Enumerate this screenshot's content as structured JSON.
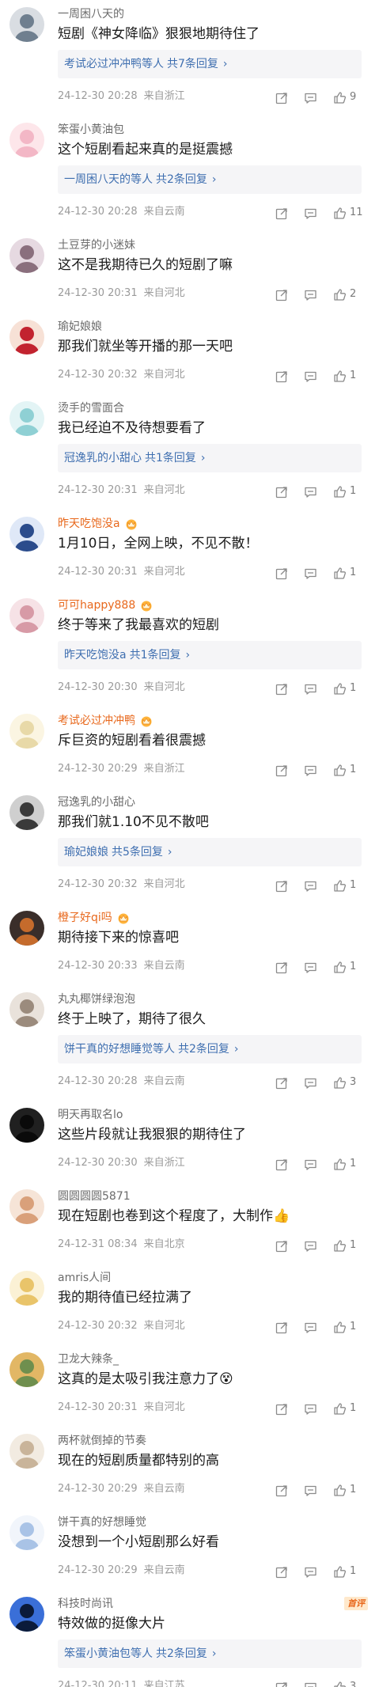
{
  "comments": [
    {
      "user": "一周困八天的",
      "vip": false,
      "text": "短剧《神女降临》狠狠地期待住了",
      "reply": {
        "names": "考试必过冲冲鸭",
        "suffix": "等人",
        "count": "共7条回复",
        "chev": "›"
      },
      "date": "24-12-30 20:28",
      "location": "来自浙江",
      "likes": "9",
      "avatar_colors": [
        "#6f7f8f",
        "#d9dde2"
      ]
    },
    {
      "user": "笨蛋小黄油包",
      "vip": false,
      "text": "这个短剧看起来真的是挺震撼",
      "reply": {
        "names": "一周困八天的",
        "suffix": "等人",
        "count": "共2条回复",
        "chev": "›"
      },
      "date": "24-12-30 20:28",
      "location": "来自云南",
      "likes": "11",
      "avatar_colors": [
        "#f3b7c6",
        "#fde6ea"
      ]
    },
    {
      "user": "土豆芽的小迷妹",
      "vip": false,
      "text": "这不是我期待已久的短剧了嘛",
      "reply": null,
      "date": "24-12-30 20:31",
      "location": "来自河北",
      "likes": "2",
      "avatar_colors": [
        "#8a6f7d",
        "#e6d9e1"
      ]
    },
    {
      "user": "瑜妃娘娘",
      "vip": false,
      "text": "那我们就坐等开播的那一天吧",
      "reply": null,
      "date": "24-12-30 20:32",
      "location": "来自河北",
      "likes": "1",
      "avatar_colors": [
        "#c2232f",
        "#f7e1d6"
      ]
    },
    {
      "user": "烫手的雪面合",
      "vip": false,
      "text": "我已经迫不及待想要看了",
      "reply": {
        "names": "冠逸乳的小甜心",
        "suffix": "",
        "count": "共1条回复",
        "chev": "›"
      },
      "date": "24-12-30 20:31",
      "location": "来自河北",
      "likes": "1",
      "avatar_colors": [
        "#8fd0d4",
        "#e3f4f5"
      ]
    },
    {
      "user": "昨天吃饱没a",
      "vip": true,
      "text": "1月10日，全网上映，不见不散！",
      "reply": null,
      "date": "24-12-30 20:31",
      "location": "来自河北",
      "likes": "1",
      "avatar_colors": [
        "#2b4c8c",
        "#dfe8f7"
      ]
    },
    {
      "user": "可可happy888",
      "vip": true,
      "text": "终于等来了我最喜欢的短剧",
      "reply": {
        "names": "昨天吃饱没a",
        "suffix": "",
        "count": "共1条回复",
        "chev": "›"
      },
      "date": "24-12-30 20:30",
      "location": "来自河北",
      "likes": "1",
      "avatar_colors": [
        "#d79aa6",
        "#f6e2e6"
      ]
    },
    {
      "user": "考试必过冲冲鸭",
      "vip": true,
      "text": "斥巨资的短剧看着很震撼",
      "reply": null,
      "date": "24-12-30 20:29",
      "location": "来自浙江",
      "likes": "1",
      "avatar_colors": [
        "#e8d9a8",
        "#fbf5e2"
      ]
    },
    {
      "user": "冠逸乳的小甜心",
      "vip": false,
      "text": "那我们就1.10不见不散吧",
      "reply": {
        "names": "瑜妃娘娘",
        "suffix": "",
        "count": "共5条回复",
        "chev": "›"
      },
      "date": "24-12-30 20:32",
      "location": "来自河北",
      "likes": "1",
      "avatar_colors": [
        "#3a3a3a",
        "#cfcfcf"
      ]
    },
    {
      "user": "橙子好qi吗",
      "vip": true,
      "text": "期待接下来的惊喜吧",
      "reply": null,
      "date": "24-12-30 20:33",
      "location": "来自云南",
      "likes": "1",
      "avatar_colors": [
        "#c56b2c",
        "#3a2e2a"
      ]
    },
    {
      "user": "丸丸椰饼绿泡泡",
      "vip": false,
      "text": "终于上映了，期待了很久",
      "reply": {
        "names": "饼干真的好想睡觉",
        "suffix": "等人",
        "count": "共2条回复",
        "chev": "›"
      },
      "date": "24-12-30 20:28",
      "location": "来自云南",
      "likes": "3",
      "avatar_colors": [
        "#9b8b7d",
        "#e9e2db"
      ]
    },
    {
      "user": "明天再取名lo",
      "vip": false,
      "text": "这些片段就让我狠狠的期待住了",
      "reply": null,
      "date": "24-12-30 20:30",
      "location": "来自浙江",
      "likes": "1",
      "avatar_colors": [
        "#0a0a0a",
        "#202020"
      ]
    },
    {
      "user": "圆圆圆圆5871",
      "vip": false,
      "text": "现在短剧也卷到这个程度了，大制作👍",
      "reply": null,
      "date": "24-12-31 08:34",
      "location": "来自北京",
      "likes": "1",
      "avatar_colors": [
        "#d9a07a",
        "#f6e4d7"
      ]
    },
    {
      "user": "amris人间",
      "vip": false,
      "text": "我的期待值已经拉满了",
      "reply": null,
      "date": "24-12-30 20:32",
      "location": "来自河北",
      "likes": "1",
      "avatar_colors": [
        "#e9c46a",
        "#fbf1d5"
      ]
    },
    {
      "user": "卫龙大辣条_",
      "vip": false,
      "text": "这真的是太吸引我注意力了😵",
      "reply": null,
      "date": "24-12-30 20:31",
      "location": "来自河北",
      "likes": "1",
      "avatar_colors": [
        "#6f8f4e",
        "#e2b765"
      ]
    },
    {
      "user": "两杯就倒掉的节奏",
      "vip": false,
      "text": "现在的短剧质量都特别的高",
      "reply": null,
      "date": "24-12-30 20:29",
      "location": "来自云南",
      "likes": "1",
      "avatar_colors": [
        "#c9b49a",
        "#f2ebe1"
      ]
    },
    {
      "user": "饼干真的好想睡觉",
      "vip": false,
      "text": "没想到一个小短剧那么好看",
      "reply": null,
      "date": "24-12-30 20:29",
      "location": "来自云南",
      "likes": "1",
      "avatar_colors": [
        "#a9c3e6",
        "#f1f5fb"
      ]
    },
    {
      "user": "科技时尚讯",
      "vip": false,
      "text": "特效做的挺像大片",
      "badge": "首评",
      "reply": {
        "names": "笨蛋小黄油包",
        "suffix": "等人",
        "count": "共2条回复",
        "chev": "›"
      },
      "date": "24-12-30 20:11",
      "location": "来自江苏",
      "likes": "3",
      "avatar_colors": [
        "#0b1b3a",
        "#3a6fd8"
      ]
    }
  ],
  "colors": {
    "link": "#3f6fb0",
    "vip_name": "#e8681c",
    "meta": "#9a9a9a",
    "reply_bg": "#f5f5f7"
  },
  "icons": {
    "share": "share-icon",
    "comment": "comment-icon",
    "like": "like-icon",
    "crown": "vip-crown-icon"
  }
}
